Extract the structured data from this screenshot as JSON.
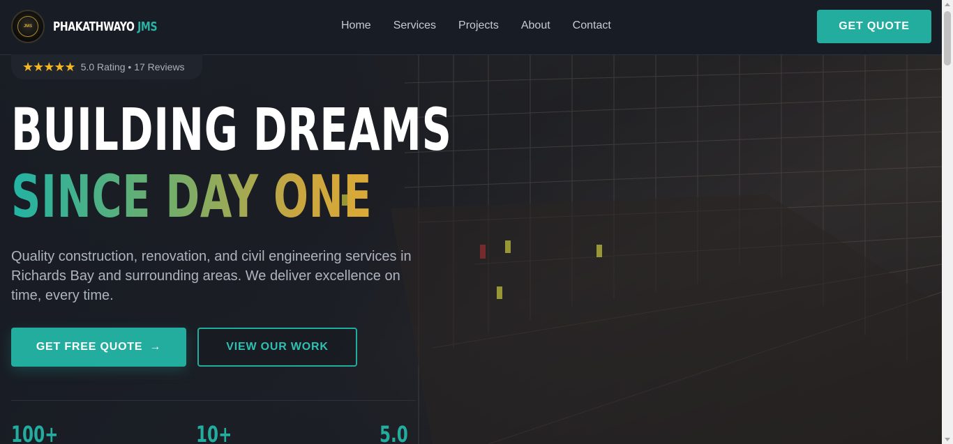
{
  "header": {
    "brand_main": "PHAKATHWAYO",
    "brand_accent": "JMS",
    "logo_text": "JMS",
    "nav": [
      "Home",
      "Services",
      "Projects",
      "About",
      "Contact"
    ],
    "cta_label": "GET QUOTE"
  },
  "hero": {
    "stars": "★★★★★",
    "rating_text": "5.0 Rating • 17 Reviews",
    "headline_line1": "BUILDING DREAMS",
    "headline_line2": "SINCE DAY ONE",
    "subtext": "Quality construction, renovation, and civil engineering services in Richards Bay and surrounding areas. We deliver excellence on time, every time.",
    "primary_button": "GET FREE QUOTE",
    "primary_arrow": "→",
    "secondary_button": "VIEW OUR WORK"
  },
  "stats": [
    "100+",
    "10+",
    "5.0"
  ],
  "colors": {
    "accent": "#23ad9f",
    "star": "#f5b623",
    "background": "#161a22"
  }
}
